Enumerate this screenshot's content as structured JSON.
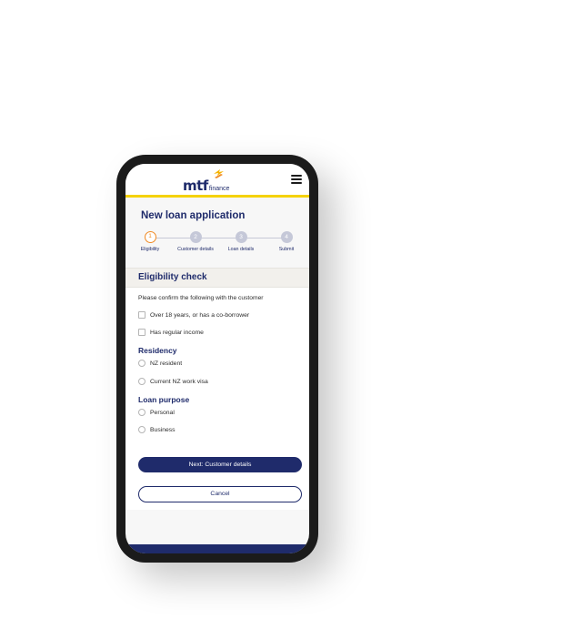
{
  "brand": {
    "logo_main": "mtf",
    "logo_sub": "finance",
    "colors": {
      "navy": "#1f2b6b",
      "yellow": "#f5d200",
      "orange": "#f08a24"
    }
  },
  "header": {
    "menu_icon": "hamburger-menu-icon"
  },
  "page": {
    "title": "New loan application"
  },
  "steps": [
    {
      "number": "1",
      "label": "Eligibility",
      "active": true
    },
    {
      "number": "2",
      "label": "Customer details",
      "active": false
    },
    {
      "number": "3",
      "label": "Loan details",
      "active": false
    },
    {
      "number": "4",
      "label": "Submit",
      "active": false
    }
  ],
  "eligibility": {
    "title": "Eligibility check",
    "intro": "Please confirm the following with the customer",
    "checks": [
      {
        "label": "Over 18 years, or has a co-borrower",
        "checked": false
      },
      {
        "label": "Has regular income",
        "checked": false
      }
    ]
  },
  "residency": {
    "title": "Residency",
    "options": [
      {
        "label": "NZ resident",
        "selected": false
      },
      {
        "label": "Current NZ work visa",
        "selected": false
      }
    ]
  },
  "loan_purpose": {
    "title": "Loan purpose",
    "options": [
      {
        "label": "Personal",
        "selected": false
      },
      {
        "label": "Business",
        "selected": false
      }
    ]
  },
  "actions": {
    "next_label": "Next: Customer details",
    "cancel_label": "Cancel"
  }
}
